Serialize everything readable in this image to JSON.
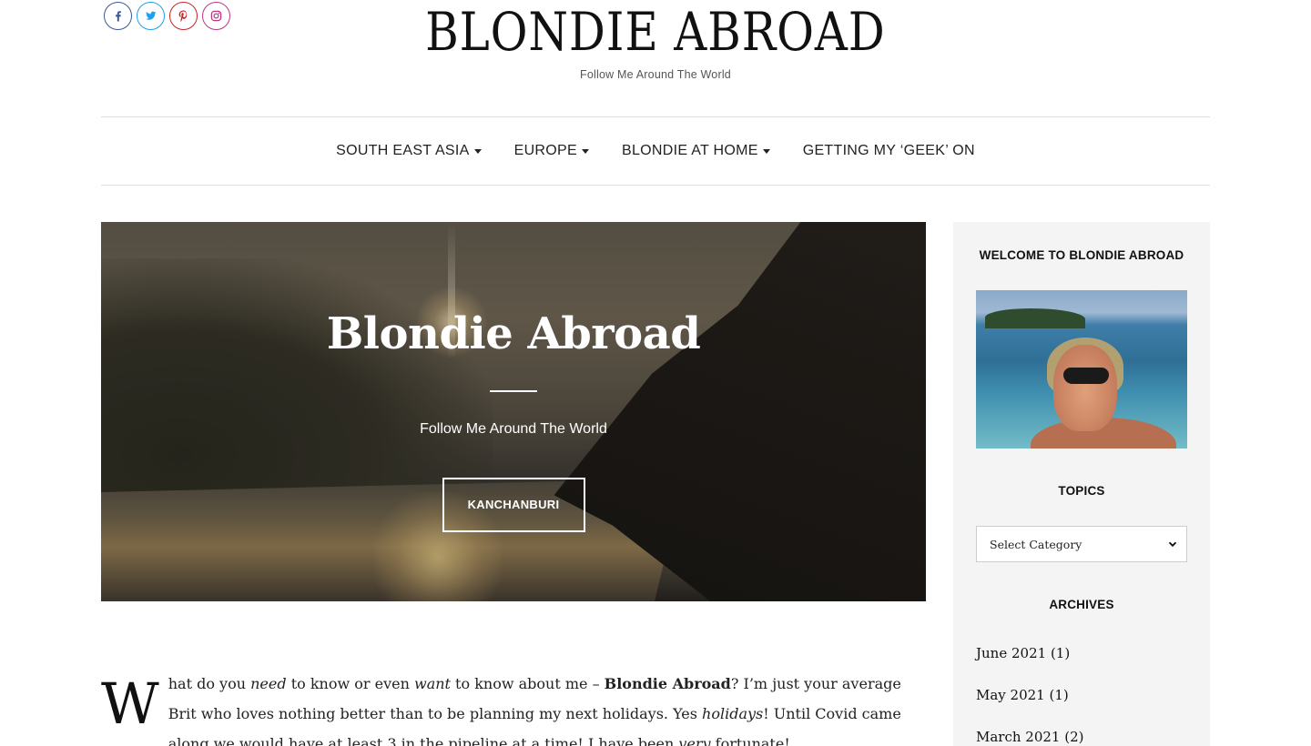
{
  "social": {
    "items": [
      {
        "name": "facebook",
        "color": "#3b5998",
        "glyph": "f"
      },
      {
        "name": "twitter",
        "color": "#1da1f2",
        "glyph": "t"
      },
      {
        "name": "pinterest",
        "color": "#cb2027",
        "glyph": "P"
      },
      {
        "name": "instagram",
        "color": "#c13584",
        "glyph": "ig"
      }
    ]
  },
  "header": {
    "site_title": "BLONDIE ABROAD",
    "tagline": "Follow Me Around The World"
  },
  "nav": {
    "items": [
      {
        "label": "SOUTH EAST ASIA",
        "has_dropdown": true
      },
      {
        "label": "EUROPE",
        "has_dropdown": true
      },
      {
        "label": "BLONDIE AT HOME",
        "has_dropdown": true
      },
      {
        "label": "GETTING MY ‘GEEK’ ON",
        "has_dropdown": false
      }
    ]
  },
  "hero": {
    "title": "Blondie Abroad",
    "tagline": "Follow Me Around The World",
    "button_label": "KANCHANBURI"
  },
  "intro": {
    "dropcap": "W",
    "seg1": "hat do you ",
    "em1": "need",
    "seg2": " to know or even ",
    "em2": "want",
    "seg3": " to know about me – ",
    "strong1": "Blondie Abroad",
    "seg4": "? I’m just your average Brit who loves nothing better than to be planning my next holidays. Yes ",
    "em3": "holidays",
    "seg5": "! Until Covid came along we would have at least 3 in the pipeline at a time! I have been ",
    "em4": "very",
    "seg6": " fortunate!"
  },
  "sidebar": {
    "welcome_title": "WELCOME TO BLONDIE ABROAD",
    "topics_title": "TOPICS",
    "category_select": "Select Category",
    "archives_title": "ARCHIVES",
    "archives": [
      {
        "label": "June 2021",
        "count": "(1)"
      },
      {
        "label": "May 2021",
        "count": "(1)"
      },
      {
        "label": "March 2021",
        "count": "(2)"
      }
    ]
  }
}
